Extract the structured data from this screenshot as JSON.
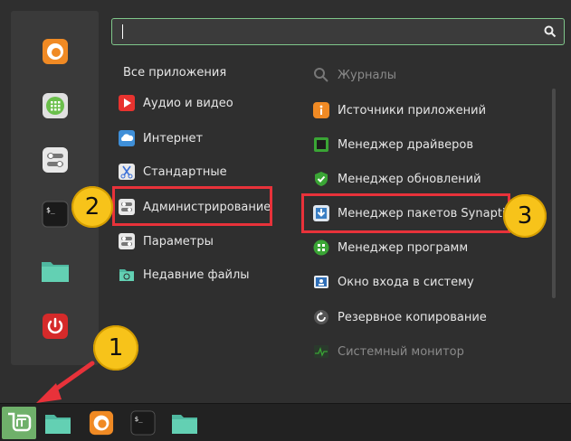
{
  "search": {
    "value": "",
    "placeholder": ""
  },
  "favorites": [
    {
      "icon": "firefox-icon"
    },
    {
      "icon": "calculator-icon"
    },
    {
      "icon": "settings-toggle-icon"
    },
    {
      "icon": "terminal-icon"
    },
    {
      "icon": "folder-icon"
    },
    {
      "icon": "power-icon"
    }
  ],
  "categories": {
    "all": "Все приложения",
    "audio_video": "Аудио и видео",
    "internet": "Интернет",
    "standard": "Стандартные",
    "admin": "Администрирование",
    "params": "Параметры",
    "recent": "Недавние файлы"
  },
  "apps": {
    "logs": "Журналы",
    "sources": "Источники приложений",
    "drivers": "Менеджер драйверов",
    "updates": "Менеджер обновлений",
    "synaptic": "Менеджер пакетов Synaptic",
    "software": "Менеджер программ",
    "login": "Окно входа в систему",
    "backup": "Резервное копирование",
    "monitor": "Системный монитор"
  },
  "badges": {
    "one": "1",
    "two": "2",
    "three": "3"
  },
  "colors": {
    "accent_green": "#7fc78a",
    "highlight_red": "#e8323a",
    "badge_yellow": "#f7c31a"
  }
}
